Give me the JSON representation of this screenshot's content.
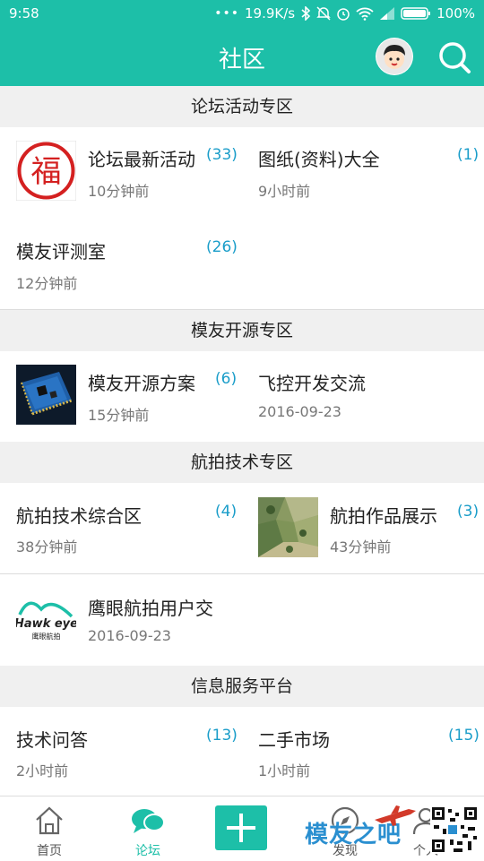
{
  "status": {
    "time": "9:58",
    "speed": "19.9K/s",
    "battery": "100%",
    "icons": [
      "dots-icon",
      "bluetooth-icon",
      "mute-icon",
      "alarm-icon",
      "wifi-icon",
      "signal-icon",
      "battery-icon"
    ]
  },
  "header": {
    "title": "社区",
    "accent": "#1dbfa8"
  },
  "sections": {
    "s1": {
      "title": "论坛活动专区",
      "items": [
        {
          "name": "论坛最新活动",
          "count": "(33)",
          "time": "10分钟前"
        },
        {
          "name": "图纸(资料)大全",
          "count": "(1)",
          "time": "9小时前"
        },
        {
          "name": "模友评测室",
          "count": "(26)",
          "time": "12分钟前"
        }
      ],
      "logo_text": "福"
    },
    "s2": {
      "title": "模友开源专区",
      "items": [
        {
          "name": "模友开源方案",
          "count": "(6)",
          "time": "15分钟前"
        },
        {
          "name": "飞控开发交流",
          "time": "2016-09-23"
        }
      ]
    },
    "s3": {
      "title": "航拍技术专区",
      "items": [
        {
          "name": "航拍技术综合区",
          "count": "(4)",
          "time": "38分钟前"
        },
        {
          "name": "航拍作品展示",
          "count": "(3)",
          "time": "43分钟前"
        },
        {
          "name": "鹰眼航拍用户交",
          "time": "2016-09-23"
        }
      ],
      "hawkeye_logo": {
        "text": "Hawk eye",
        "subtext": "鹰眼航拍"
      }
    },
    "s4": {
      "title": "信息服务平台",
      "items": [
        {
          "name": "技术问答",
          "count": "(13)",
          "time": "2小时前"
        },
        {
          "name": "二手市场",
          "count": "(15)",
          "time": "1小时前"
        }
      ]
    }
  },
  "tabs": [
    {
      "label": "首页",
      "icon": "home-icon"
    },
    {
      "label": "论坛",
      "icon": "chat-icon"
    },
    {
      "label": "",
      "icon": "plus-icon"
    },
    {
      "label": "发现",
      "icon": "discover-icon"
    },
    {
      "label": "个人",
      "icon": "person-icon"
    }
  ],
  "watermark": {
    "text": "模友之吧"
  }
}
